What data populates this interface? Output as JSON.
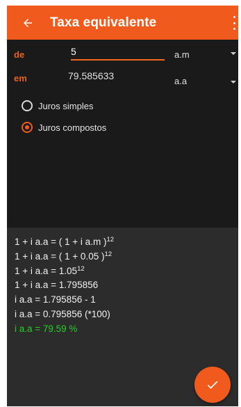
{
  "appbar": {
    "title": "Taxa equivalente",
    "back_icon": "arrow-left-icon",
    "menu_icon": "more-vert-icon",
    "color": "#f05a1c"
  },
  "form": {
    "de_label": "de",
    "em_label": "em",
    "de_value": "5",
    "em_value": "79.585633",
    "de_unit": "a.m",
    "em_unit": "a.a"
  },
  "options": {
    "simples_label": "Juros simples",
    "compostos_label": "Juros compostos",
    "selected": "compostos"
  },
  "result": {
    "l1_base": "1 + i a.a = ( 1 + i a.m )",
    "l1_exp": "12",
    "l2_base": "1 + i a.a = ( 1 + 0.05 )",
    "l2_exp": "12",
    "l3_base": "1 + i a.a = 1.05",
    "l3_exp": "12",
    "l4": "1 + i a.a = 1.795856",
    "l5": "i a.a = 1.795856 - 1",
    "l6": "i a.a = 0.795856 (*100)",
    "l7": "i a.a = 79.59 %",
    "highlight_color": "#23d023"
  },
  "fab": {
    "icon": "check-icon"
  }
}
